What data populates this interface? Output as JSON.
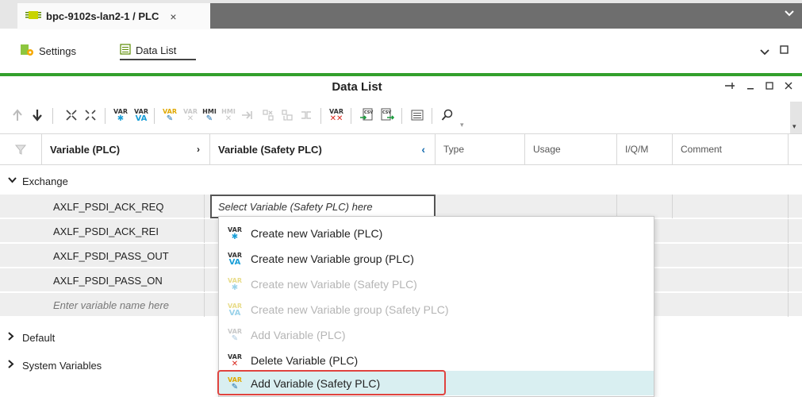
{
  "doc_tab": {
    "title": "bpc-9102s-lan2-1 / PLC",
    "close": "×"
  },
  "subtabs": [
    {
      "label": "Settings"
    },
    {
      "label": "Data List"
    }
  ],
  "panel": {
    "title": "Data List"
  },
  "toolbar_icons": {
    "up": "arrow-up-icon",
    "down": "arrow-down-icon",
    "var": "VAR"
  },
  "columns": [
    {
      "label": "Variable (PLC)"
    },
    {
      "label": "Variable (Safety PLC)"
    },
    {
      "label": "Type"
    },
    {
      "label": "Usage"
    },
    {
      "label": "I/Q/M"
    },
    {
      "label": "Comment"
    }
  ],
  "groups": {
    "exchange": "Exchange",
    "default": "Default",
    "system": "System Variables"
  },
  "rows": [
    {
      "name": "AXLF_PSDI_ACK_REQ"
    },
    {
      "name": "AXLF_PSDI_ACK_REI"
    },
    {
      "name": "AXLF_PSDI_PASS_OUT"
    },
    {
      "name": "AXLF_PSDI_PASS_ON"
    }
  ],
  "new_row_placeholder": "Enter variable name here",
  "safety_cell_placeholder": "Select Variable (Safety PLC) here",
  "context_menu": [
    {
      "label": "Create new Variable (PLC)",
      "enabled": true
    },
    {
      "label": "Create new Variable group (PLC)",
      "enabled": true
    },
    {
      "label": "Create new Variable (Safety PLC)",
      "enabled": false
    },
    {
      "label": "Create new Variable group (Safety PLC)",
      "enabled": false
    },
    {
      "label": "Add Variable (PLC)",
      "enabled": false
    },
    {
      "label": "Delete Variable (PLC)",
      "enabled": true
    },
    {
      "label": "Add Variable (Safety PLC)",
      "enabled": true,
      "highlighted": true
    }
  ],
  "colors": {
    "accent_green": "#33a02c",
    "highlight": "#d9eff1",
    "annotation_red": "#e0433f"
  }
}
